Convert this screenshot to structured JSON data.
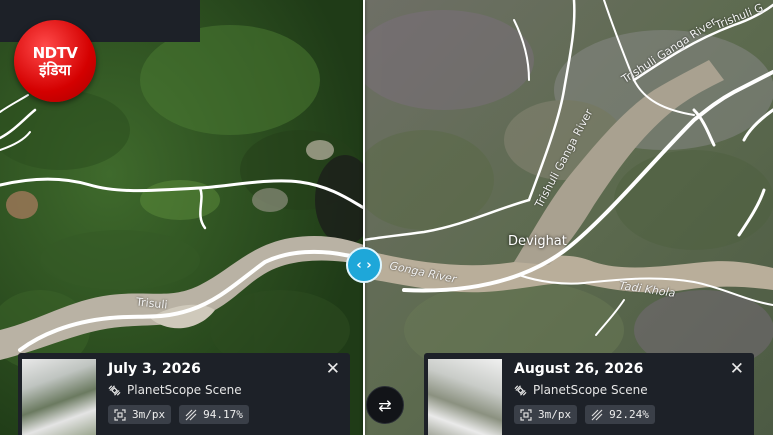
{
  "logo": {
    "line1": "NDTV",
    "line2": "इंडिया"
  },
  "map_labels": {
    "left_river": "Trisuli",
    "right_river_top": "Trishuli Ganga River",
    "right_river_top2": "Trishuli G",
    "right_river_mid": "Trishuli Ganga River",
    "gonga_river": "Gonga River",
    "tadi_khola": "Tadi Khola",
    "devighat": "Devighat"
  },
  "compare_handle": {
    "glyph": "‹ ›"
  },
  "left_card": {
    "date": "July 3, 2026",
    "source": "PlanetScope Scene",
    "resolution": "3m/px",
    "coverage": "94.17%",
    "close_glyph": "✕"
  },
  "right_card": {
    "date": "August 26, 2026",
    "source": "PlanetScope Scene",
    "resolution": "3m/px",
    "coverage": "92.24%",
    "close_glyph": "✕"
  },
  "swap_button": {
    "glyph": "⇄"
  },
  "colors": {
    "handle": "#1ea7d9",
    "card_bg": "#1d2128",
    "logo_red": "#d40000"
  }
}
